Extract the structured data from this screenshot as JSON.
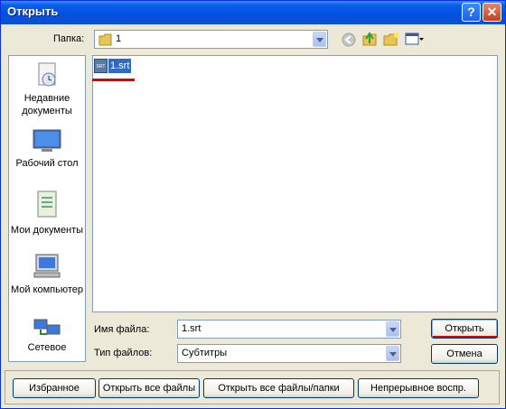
{
  "window": {
    "title": "Открыть"
  },
  "toolbar": {
    "folder_label": "Папка:",
    "folder_value": "1"
  },
  "places": [
    {
      "label": "Недавние документы",
      "icon": "recent-documents-icon"
    },
    {
      "label": "Рабочий стол",
      "icon": "desktop-icon"
    },
    {
      "label": "Мои документы",
      "icon": "my-documents-icon"
    },
    {
      "label": "Мой компьютер",
      "icon": "my-computer-icon"
    },
    {
      "label": "Сетевое",
      "icon": "network-icon"
    }
  ],
  "files": [
    {
      "name": "1.srt",
      "icon": "srt-file-icon",
      "badge": "SRT"
    }
  ],
  "form": {
    "filename_label": "Имя файла:",
    "filename_value": "1.srt",
    "filetype_label": "Тип файлов:",
    "filetype_value": "Субтитры"
  },
  "buttons": {
    "open": "Открыть",
    "cancel": "Отмена"
  },
  "bottom_buttons": [
    "Избранное",
    "Открыть все файлы",
    "Открыть все файлы/папки",
    "Непрерывное воспр."
  ],
  "colors": {
    "titlebar": "#0451e0",
    "selection": "#316ac5",
    "annotation_red": "#e00000",
    "dialog_bg": "#ece9d8"
  }
}
